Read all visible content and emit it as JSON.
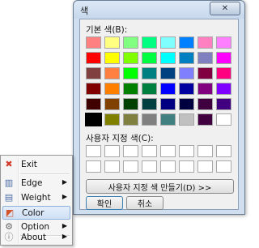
{
  "dialog": {
    "title": "색",
    "close_symbol": "✕",
    "basic_colors_label": "기본 색(B):",
    "custom_colors_label": "사용자 지정 색(C):",
    "define_custom_button": "사용자 지정 색 만들기(D) >>",
    "ok_button": "확인",
    "cancel_button": "취소",
    "basic_colors": [
      "#ff8080",
      "#ffff80",
      "#80ff80",
      "#00ff80",
      "#80ffff",
      "#0080ff",
      "#ff80c0",
      "#ff80ff",
      "#ff0000",
      "#ffff00",
      "#80ff00",
      "#00ff40",
      "#00ffff",
      "#0080c0",
      "#8080c0",
      "#ff00ff",
      "#804040",
      "#ff8040",
      "#00ff00",
      "#008080",
      "#004080",
      "#8080ff",
      "#800040",
      "#ff0080",
      "#800000",
      "#ff8000",
      "#008000",
      "#008040",
      "#0000ff",
      "#0000a0",
      "#800080",
      "#8000ff",
      "#400000",
      "#804000",
      "#004000",
      "#004040",
      "#000080",
      "#000040",
      "#400040",
      "#400080",
      "#000000",
      "#808000",
      "#808040",
      "#808080",
      "#408080",
      "#c0c0c0",
      "#400040",
      "#ffffff"
    ],
    "selected_index": 40,
    "custom_colors_count": 16
  },
  "menu": {
    "items": [
      {
        "label": "Exit",
        "icon": "exit-icon",
        "glyph": "✖",
        "color": "#d23b2b",
        "submenu": false
      },
      {
        "label": "Edge",
        "icon": "edge-icon",
        "glyph": "▥",
        "color": "#4a6ea8",
        "submenu": true
      },
      {
        "label": "Weight",
        "icon": "weight-icon",
        "glyph": "▤",
        "color": "#4a6ea8",
        "submenu": true
      },
      {
        "label": "Color",
        "icon": "color-palette-icon",
        "glyph": "◩",
        "color": "#d4542c",
        "submenu": false
      },
      {
        "label": "Option",
        "icon": "gear-icon",
        "glyph": "⚙",
        "color": "#666666",
        "submenu": true
      },
      {
        "label": "About",
        "icon": "info-icon",
        "glyph": "ⓘ",
        "color": "#777777",
        "submenu": true
      }
    ],
    "submenu_arrow": "▶"
  }
}
